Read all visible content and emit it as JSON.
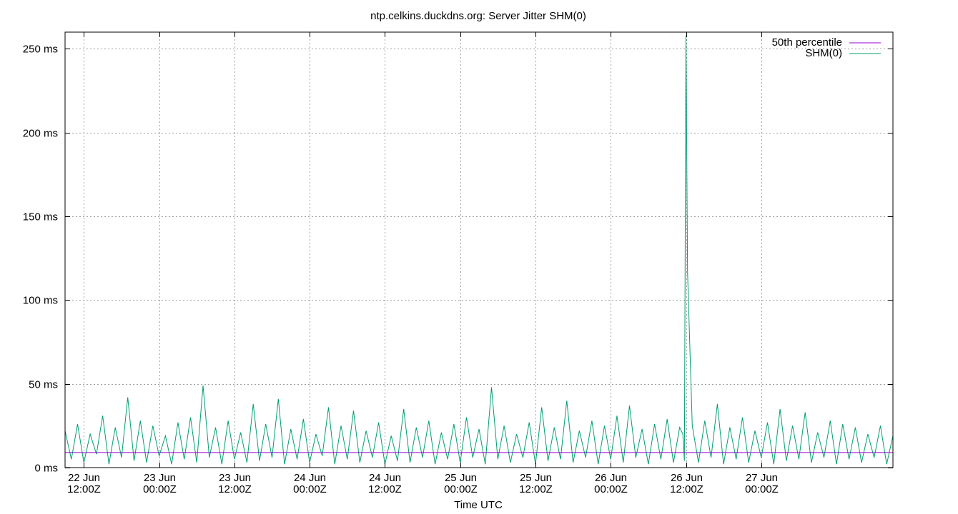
{
  "chart_data": {
    "type": "line",
    "title": "ntp.celkins.duckdns.org: Server Jitter SHM(0)",
    "xlabel": "Time UTC",
    "ylabel": "",
    "y_unit": "ms",
    "ylim": [
      0,
      260
    ],
    "xlim": [
      "2025-06-22T09:00Z",
      "2025-06-27T21:00Z"
    ],
    "grid": true,
    "legend_position": "top-right",
    "yticks": [
      {
        "value": 0,
        "label": "0 ms"
      },
      {
        "value": 50,
        "label": "50 ms"
      },
      {
        "value": 100,
        "label": "100 ms"
      },
      {
        "value": 150,
        "label": "150 ms"
      },
      {
        "value": 200,
        "label": "200 ms"
      },
      {
        "value": 250,
        "label": "250 ms"
      }
    ],
    "xticks": [
      {
        "value": "2025-06-22T12:00Z",
        "line1": "22 Jun",
        "line2": "12:00Z"
      },
      {
        "value": "2025-06-23T00:00Z",
        "line1": "23 Jun",
        "line2": "00:00Z"
      },
      {
        "value": "2025-06-23T12:00Z",
        "line1": "23 Jun",
        "line2": "12:00Z"
      },
      {
        "value": "2025-06-24T00:00Z",
        "line1": "24 Jun",
        "line2": "00:00Z"
      },
      {
        "value": "2025-06-24T12:00Z",
        "line1": "24 Jun",
        "line2": "12:00Z"
      },
      {
        "value": "2025-06-25T00:00Z",
        "line1": "25 Jun",
        "line2": "00:00Z"
      },
      {
        "value": "2025-06-25T12:00Z",
        "line1": "25 Jun",
        "line2": "12:00Z"
      },
      {
        "value": "2025-06-26T00:00Z",
        "line1": "26 Jun",
        "line2": "00:00Z"
      },
      {
        "value": "2025-06-26T12:00Z",
        "line1": "26 Jun",
        "line2": "12:00Z"
      },
      {
        "value": "2025-06-27T00:00Z",
        "line1": "27 Jun",
        "line2": "00:00Z"
      }
    ],
    "series": [
      {
        "name": "50th percentile",
        "color": "#9400d3",
        "x": [
          "2025-06-22T09:00Z",
          "2025-06-27T21:00Z"
        ],
        "values": [
          9,
          9
        ]
      },
      {
        "name": "SHM(0)",
        "color": "#009e73",
        "x": [
          "2025-06-22T09:00Z",
          "2025-06-22T10:00Z",
          "2025-06-22T11:00Z",
          "2025-06-22T12:00Z",
          "2025-06-22T13:00Z",
          "2025-06-22T14:00Z",
          "2025-06-22T15:00Z",
          "2025-06-22T16:00Z",
          "2025-06-22T17:00Z",
          "2025-06-22T18:00Z",
          "2025-06-22T19:00Z",
          "2025-06-22T20:00Z",
          "2025-06-22T21:00Z",
          "2025-06-22T22:00Z",
          "2025-06-22T23:00Z",
          "2025-06-23T00:00Z",
          "2025-06-23T01:00Z",
          "2025-06-23T02:00Z",
          "2025-06-23T03:00Z",
          "2025-06-23T04:00Z",
          "2025-06-23T05:00Z",
          "2025-06-23T06:00Z",
          "2025-06-23T07:00Z",
          "2025-06-23T08:00Z",
          "2025-06-23T09:00Z",
          "2025-06-23T10:00Z",
          "2025-06-23T11:00Z",
          "2025-06-23T12:00Z",
          "2025-06-23T13:00Z",
          "2025-06-23T14:00Z",
          "2025-06-23T15:00Z",
          "2025-06-23T16:00Z",
          "2025-06-23T17:00Z",
          "2025-06-23T18:00Z",
          "2025-06-23T19:00Z",
          "2025-06-23T20:00Z",
          "2025-06-23T21:00Z",
          "2025-06-23T22:00Z",
          "2025-06-23T23:00Z",
          "2025-06-24T00:00Z",
          "2025-06-24T01:00Z",
          "2025-06-24T02:00Z",
          "2025-06-24T03:00Z",
          "2025-06-24T04:00Z",
          "2025-06-24T05:00Z",
          "2025-06-24T06:00Z",
          "2025-06-24T07:00Z",
          "2025-06-24T08:00Z",
          "2025-06-24T09:00Z",
          "2025-06-24T10:00Z",
          "2025-06-24T11:00Z",
          "2025-06-24T12:00Z",
          "2025-06-24T13:00Z",
          "2025-06-24T14:00Z",
          "2025-06-24T15:00Z",
          "2025-06-24T16:00Z",
          "2025-06-24T17:00Z",
          "2025-06-24T18:00Z",
          "2025-06-24T19:00Z",
          "2025-06-24T20:00Z",
          "2025-06-24T21:00Z",
          "2025-06-24T22:00Z",
          "2025-06-24T23:00Z",
          "2025-06-25T00:00Z",
          "2025-06-25T01:00Z",
          "2025-06-25T02:00Z",
          "2025-06-25T03:00Z",
          "2025-06-25T04:00Z",
          "2025-06-25T05:00Z",
          "2025-06-25T06:00Z",
          "2025-06-25T07:00Z",
          "2025-06-25T08:00Z",
          "2025-06-25T09:00Z",
          "2025-06-25T10:00Z",
          "2025-06-25T11:00Z",
          "2025-06-25T12:00Z",
          "2025-06-25T13:00Z",
          "2025-06-25T14:00Z",
          "2025-06-25T15:00Z",
          "2025-06-25T16:00Z",
          "2025-06-25T17:00Z",
          "2025-06-25T18:00Z",
          "2025-06-25T19:00Z",
          "2025-06-25T20:00Z",
          "2025-06-25T21:00Z",
          "2025-06-25T22:00Z",
          "2025-06-25T23:00Z",
          "2025-06-26T00:00Z",
          "2025-06-26T01:00Z",
          "2025-06-26T02:00Z",
          "2025-06-26T03:00Z",
          "2025-06-26T04:00Z",
          "2025-06-26T05:00Z",
          "2025-06-26T06:00Z",
          "2025-06-26T07:00Z",
          "2025-06-26T08:00Z",
          "2025-06-26T09:00Z",
          "2025-06-26T10:00Z",
          "2025-06-26T11:00Z",
          "2025-06-26T11:30Z",
          "2025-06-26T11:45Z",
          "2025-06-26T12:00Z",
          "2025-06-26T12:15Z",
          "2025-06-26T13:00Z",
          "2025-06-26T14:00Z",
          "2025-06-26T15:00Z",
          "2025-06-26T16:00Z",
          "2025-06-26T17:00Z",
          "2025-06-26T18:00Z",
          "2025-06-26T19:00Z",
          "2025-06-26T20:00Z",
          "2025-06-26T21:00Z",
          "2025-06-26T22:00Z",
          "2025-06-26T23:00Z",
          "2025-06-27T00:00Z",
          "2025-06-27T01:00Z",
          "2025-06-27T02:00Z",
          "2025-06-27T03:00Z",
          "2025-06-27T04:00Z",
          "2025-06-27T05:00Z",
          "2025-06-27T06:00Z",
          "2025-06-27T07:00Z",
          "2025-06-27T08:00Z",
          "2025-06-27T09:00Z",
          "2025-06-27T10:00Z",
          "2025-06-27T11:00Z",
          "2025-06-27T12:00Z",
          "2025-06-27T13:00Z",
          "2025-06-27T14:00Z",
          "2025-06-27T15:00Z",
          "2025-06-27T16:00Z",
          "2025-06-27T17:00Z",
          "2025-06-27T18:00Z",
          "2025-06-27T19:00Z",
          "2025-06-27T20:00Z",
          "2025-06-27T21:00Z"
        ],
        "values": [
          22,
          5,
          26,
          3,
          20,
          8,
          31,
          2,
          24,
          6,
          42,
          4,
          28,
          3,
          25,
          7,
          19,
          2,
          27,
          5,
          30,
          3,
          49,
          6,
          24,
          2,
          28,
          5,
          21,
          3,
          38,
          4,
          26,
          6,
          41,
          2,
          23,
          5,
          29,
          3,
          20,
          7,
          36,
          2,
          25,
          5,
          34,
          3,
          22,
          6,
          27,
          2,
          19,
          4,
          35,
          3,
          24,
          6,
          28,
          2,
          21,
          5,
          26,
          3,
          30,
          6,
          23,
          2,
          48,
          5,
          25,
          3,
          20,
          6,
          27,
          2,
          36,
          4,
          24,
          5,
          40,
          3,
          22,
          6,
          28,
          2,
          25,
          5,
          31,
          3,
          37,
          6,
          23,
          2,
          26,
          5,
          29,
          3,
          24,
          20,
          4,
          258,
          117,
          25,
          3,
          28,
          6,
          38,
          2,
          24,
          5,
          30,
          3,
          22,
          6,
          27,
          2,
          35,
          4,
          25,
          5,
          33,
          3,
          21,
          6,
          28,
          2,
          26,
          5,
          24,
          3,
          20,
          6,
          25,
          2,
          19
        ]
      }
    ]
  }
}
